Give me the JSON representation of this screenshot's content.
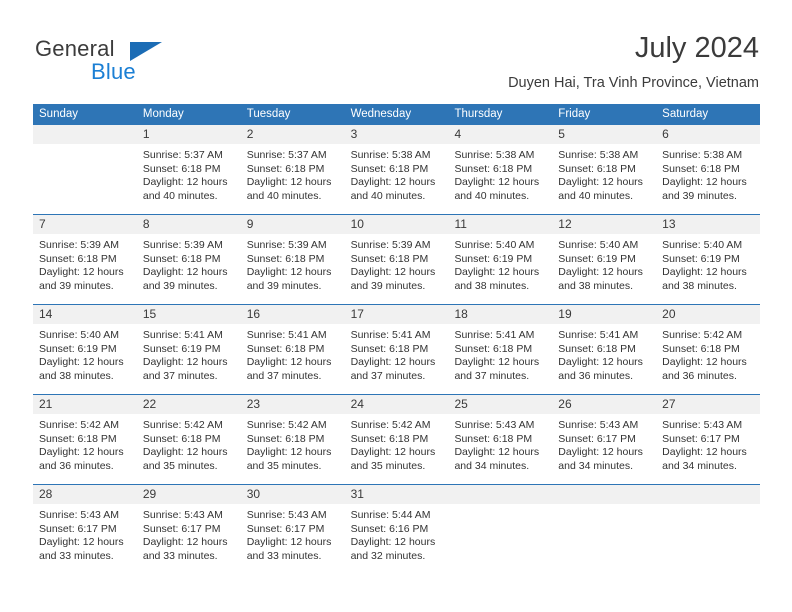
{
  "brand": {
    "name_part1": "General",
    "name_part2": "Blue",
    "accent_color": "#1b7fd4",
    "triangle_color": "#1b6cb5",
    "triangle_icon": "triangle-icon"
  },
  "header": {
    "month_title": "July 2024",
    "location": "Duyen Hai, Tra Vinh Province, Vietnam"
  },
  "calendar": {
    "header_color": "#2e75b6",
    "day_band_color": "#f1f1f1",
    "weekdays": [
      "Sunday",
      "Monday",
      "Tuesday",
      "Wednesday",
      "Thursday",
      "Friday",
      "Saturday"
    ],
    "weeks": [
      [
        {
          "day": "",
          "sunrise": "",
          "sunset": "",
          "daylight_line1": "",
          "daylight_line2": "",
          "empty": true
        },
        {
          "day": "1",
          "sunrise": "Sunrise: 5:37 AM",
          "sunset": "Sunset: 6:18 PM",
          "daylight_line1": "Daylight: 12 hours",
          "daylight_line2": "and 40 minutes."
        },
        {
          "day": "2",
          "sunrise": "Sunrise: 5:37 AM",
          "sunset": "Sunset: 6:18 PM",
          "daylight_line1": "Daylight: 12 hours",
          "daylight_line2": "and 40 minutes."
        },
        {
          "day": "3",
          "sunrise": "Sunrise: 5:38 AM",
          "sunset": "Sunset: 6:18 PM",
          "daylight_line1": "Daylight: 12 hours",
          "daylight_line2": "and 40 minutes."
        },
        {
          "day": "4",
          "sunrise": "Sunrise: 5:38 AM",
          "sunset": "Sunset: 6:18 PM",
          "daylight_line1": "Daylight: 12 hours",
          "daylight_line2": "and 40 minutes."
        },
        {
          "day": "5",
          "sunrise": "Sunrise: 5:38 AM",
          "sunset": "Sunset: 6:18 PM",
          "daylight_line1": "Daylight: 12 hours",
          "daylight_line2": "and 40 minutes."
        },
        {
          "day": "6",
          "sunrise": "Sunrise: 5:38 AM",
          "sunset": "Sunset: 6:18 PM",
          "daylight_line1": "Daylight: 12 hours",
          "daylight_line2": "and 39 minutes."
        }
      ],
      [
        {
          "day": "7",
          "sunrise": "Sunrise: 5:39 AM",
          "sunset": "Sunset: 6:18 PM",
          "daylight_line1": "Daylight: 12 hours",
          "daylight_line2": "and 39 minutes."
        },
        {
          "day": "8",
          "sunrise": "Sunrise: 5:39 AM",
          "sunset": "Sunset: 6:18 PM",
          "daylight_line1": "Daylight: 12 hours",
          "daylight_line2": "and 39 minutes."
        },
        {
          "day": "9",
          "sunrise": "Sunrise: 5:39 AM",
          "sunset": "Sunset: 6:18 PM",
          "daylight_line1": "Daylight: 12 hours",
          "daylight_line2": "and 39 minutes."
        },
        {
          "day": "10",
          "sunrise": "Sunrise: 5:39 AM",
          "sunset": "Sunset: 6:18 PM",
          "daylight_line1": "Daylight: 12 hours",
          "daylight_line2": "and 39 minutes."
        },
        {
          "day": "11",
          "sunrise": "Sunrise: 5:40 AM",
          "sunset": "Sunset: 6:19 PM",
          "daylight_line1": "Daylight: 12 hours",
          "daylight_line2": "and 38 minutes."
        },
        {
          "day": "12",
          "sunrise": "Sunrise: 5:40 AM",
          "sunset": "Sunset: 6:19 PM",
          "daylight_line1": "Daylight: 12 hours",
          "daylight_line2": "and 38 minutes."
        },
        {
          "day": "13",
          "sunrise": "Sunrise: 5:40 AM",
          "sunset": "Sunset: 6:19 PM",
          "daylight_line1": "Daylight: 12 hours",
          "daylight_line2": "and 38 minutes."
        }
      ],
      [
        {
          "day": "14",
          "sunrise": "Sunrise: 5:40 AM",
          "sunset": "Sunset: 6:19 PM",
          "daylight_line1": "Daylight: 12 hours",
          "daylight_line2": "and 38 minutes."
        },
        {
          "day": "15",
          "sunrise": "Sunrise: 5:41 AM",
          "sunset": "Sunset: 6:19 PM",
          "daylight_line1": "Daylight: 12 hours",
          "daylight_line2": "and 37 minutes."
        },
        {
          "day": "16",
          "sunrise": "Sunrise: 5:41 AM",
          "sunset": "Sunset: 6:18 PM",
          "daylight_line1": "Daylight: 12 hours",
          "daylight_line2": "and 37 minutes."
        },
        {
          "day": "17",
          "sunrise": "Sunrise: 5:41 AM",
          "sunset": "Sunset: 6:18 PM",
          "daylight_line1": "Daylight: 12 hours",
          "daylight_line2": "and 37 minutes."
        },
        {
          "day": "18",
          "sunrise": "Sunrise: 5:41 AM",
          "sunset": "Sunset: 6:18 PM",
          "daylight_line1": "Daylight: 12 hours",
          "daylight_line2": "and 37 minutes."
        },
        {
          "day": "19",
          "sunrise": "Sunrise: 5:41 AM",
          "sunset": "Sunset: 6:18 PM",
          "daylight_line1": "Daylight: 12 hours",
          "daylight_line2": "and 36 minutes."
        },
        {
          "day": "20",
          "sunrise": "Sunrise: 5:42 AM",
          "sunset": "Sunset: 6:18 PM",
          "daylight_line1": "Daylight: 12 hours",
          "daylight_line2": "and 36 minutes."
        }
      ],
      [
        {
          "day": "21",
          "sunrise": "Sunrise: 5:42 AM",
          "sunset": "Sunset: 6:18 PM",
          "daylight_line1": "Daylight: 12 hours",
          "daylight_line2": "and 36 minutes."
        },
        {
          "day": "22",
          "sunrise": "Sunrise: 5:42 AM",
          "sunset": "Sunset: 6:18 PM",
          "daylight_line1": "Daylight: 12 hours",
          "daylight_line2": "and 35 minutes."
        },
        {
          "day": "23",
          "sunrise": "Sunrise: 5:42 AM",
          "sunset": "Sunset: 6:18 PM",
          "daylight_line1": "Daylight: 12 hours",
          "daylight_line2": "and 35 minutes."
        },
        {
          "day": "24",
          "sunrise": "Sunrise: 5:42 AM",
          "sunset": "Sunset: 6:18 PM",
          "daylight_line1": "Daylight: 12 hours",
          "daylight_line2": "and 35 minutes."
        },
        {
          "day": "25",
          "sunrise": "Sunrise: 5:43 AM",
          "sunset": "Sunset: 6:18 PM",
          "daylight_line1": "Daylight: 12 hours",
          "daylight_line2": "and 34 minutes."
        },
        {
          "day": "26",
          "sunrise": "Sunrise: 5:43 AM",
          "sunset": "Sunset: 6:17 PM",
          "daylight_line1": "Daylight: 12 hours",
          "daylight_line2": "and 34 minutes."
        },
        {
          "day": "27",
          "sunrise": "Sunrise: 5:43 AM",
          "sunset": "Sunset: 6:17 PM",
          "daylight_line1": "Daylight: 12 hours",
          "daylight_line2": "and 34 minutes."
        }
      ],
      [
        {
          "day": "28",
          "sunrise": "Sunrise: 5:43 AM",
          "sunset": "Sunset: 6:17 PM",
          "daylight_line1": "Daylight: 12 hours",
          "daylight_line2": "and 33 minutes."
        },
        {
          "day": "29",
          "sunrise": "Sunrise: 5:43 AM",
          "sunset": "Sunset: 6:17 PM",
          "daylight_line1": "Daylight: 12 hours",
          "daylight_line2": "and 33 minutes."
        },
        {
          "day": "30",
          "sunrise": "Sunrise: 5:43 AM",
          "sunset": "Sunset: 6:17 PM",
          "daylight_line1": "Daylight: 12 hours",
          "daylight_line2": "and 33 minutes."
        },
        {
          "day": "31",
          "sunrise": "Sunrise: 5:44 AM",
          "sunset": "Sunset: 6:16 PM",
          "daylight_line1": "Daylight: 12 hours",
          "daylight_line2": "and 32 minutes."
        },
        {
          "day": "",
          "sunrise": "",
          "sunset": "",
          "daylight_line1": "",
          "daylight_line2": "",
          "empty": true
        },
        {
          "day": "",
          "sunrise": "",
          "sunset": "",
          "daylight_line1": "",
          "daylight_line2": "",
          "empty": true
        },
        {
          "day": "",
          "sunrise": "",
          "sunset": "",
          "daylight_line1": "",
          "daylight_line2": "",
          "empty": true
        }
      ]
    ]
  }
}
